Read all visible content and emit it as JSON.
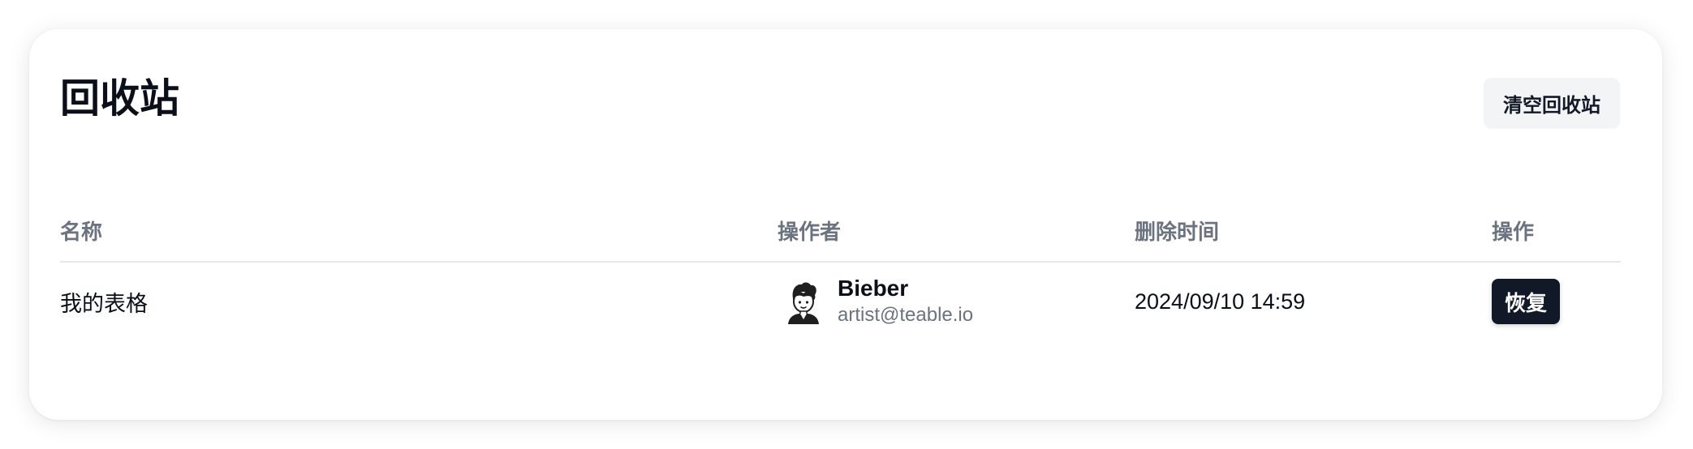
{
  "page": {
    "title": "回收站",
    "clear_button_label": "清空回收站"
  },
  "table": {
    "columns": [
      "名称",
      "操作者",
      "删除时间",
      "操作"
    ],
    "rows": [
      {
        "name": "我的表格",
        "operator": {
          "name": "Bieber",
          "email": "artist@teable.io",
          "avatar_icon": "user-avatar-icon"
        },
        "deleted_time": "2024/09/10 14:59",
        "action_label": "恢复"
      }
    ]
  },
  "colors": {
    "primary_button": "#111827",
    "secondary_button": "#f3f4f6",
    "muted_text": "#6b7280",
    "divider": "#e5e7eb"
  }
}
